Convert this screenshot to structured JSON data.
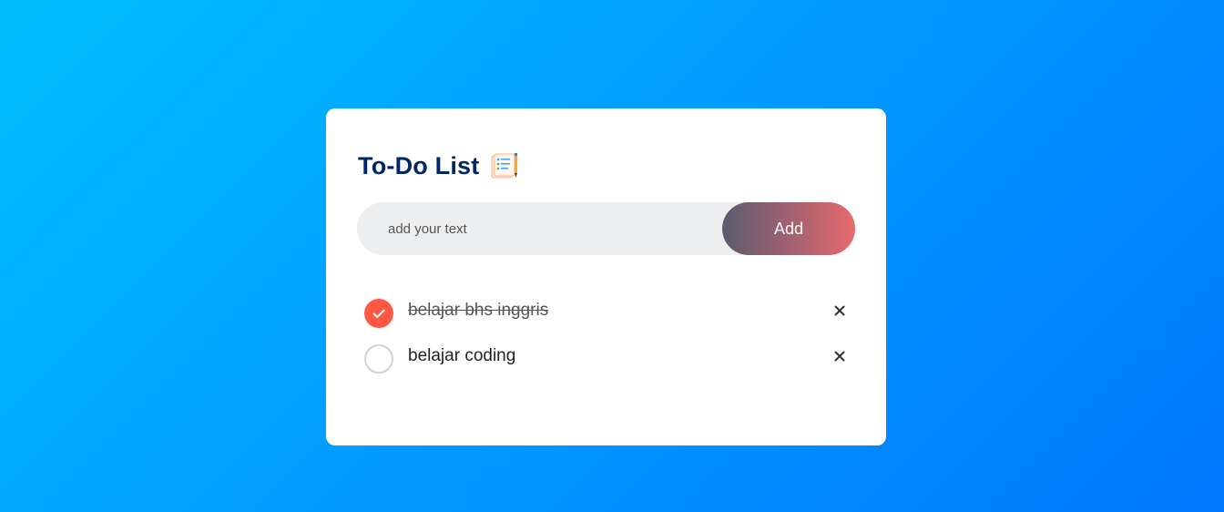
{
  "app": {
    "title": "To-Do List",
    "title_icon": "notepad-checklist-icon"
  },
  "input": {
    "placeholder": "add your text",
    "value": "",
    "add_label": "Add"
  },
  "todos": [
    {
      "text": "belajar bhs inggris",
      "checked": true
    },
    {
      "text": "belajar coding",
      "checked": false
    }
  ],
  "colors": {
    "title": "#002765",
    "checked": "#ff5945",
    "input_bg": "#edeef0",
    "button_gradient_start": "#5a5c6e",
    "button_gradient_end": "#e86a6c"
  }
}
